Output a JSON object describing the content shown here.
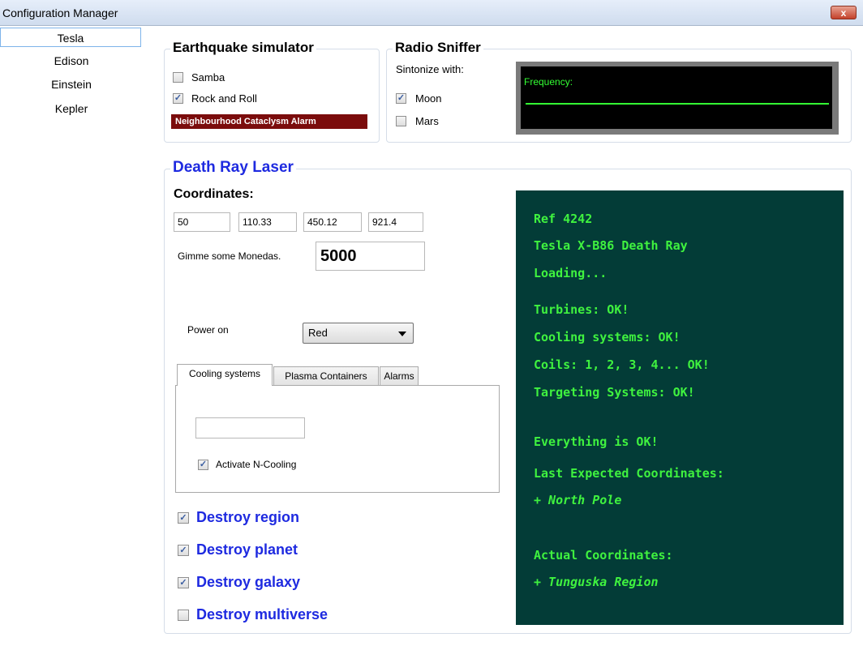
{
  "window": {
    "title": "Configuration Manager",
    "close_label": "x"
  },
  "sidebar": {
    "items": [
      {
        "label": "Tesla",
        "active": true
      },
      {
        "label": "Edison"
      },
      {
        "label": "Einstein"
      },
      {
        "label": "Kepler"
      }
    ]
  },
  "earthquake": {
    "title": "Earthquake simulator",
    "options": [
      {
        "label": "Samba",
        "checked": false
      },
      {
        "label": "Rock and Roll",
        "checked": true
      }
    ],
    "alarm_label": "Neighbourhood Cataclysm Alarm",
    "alarm_color": "#7b0c0c"
  },
  "radio": {
    "title": "Radio Sniffer",
    "subtitle": "Sintonize with:",
    "options": [
      {
        "label": "Moon",
        "checked": true
      },
      {
        "label": "Mars",
        "checked": false
      }
    ],
    "frequency_label": "Frequency:",
    "display_color": "#33ff33"
  },
  "laser": {
    "title": "Death Ray Laser",
    "title_color": "#1e2ae0",
    "coordinates_label": "Coordinates:",
    "coordinates": [
      "50",
      "110.33",
      "450.12",
      "921.4"
    ],
    "monedas_label": "Gimme some Monedas.",
    "monedas_value": "5000",
    "power_label": "Power on",
    "power_value": "Red",
    "tabs": [
      {
        "label": "Cooling systems",
        "active": true
      },
      {
        "label": "Plasma Containers"
      },
      {
        "label": "Alarms"
      }
    ],
    "cooling_input": "",
    "ncooling_label": "Activate N-Cooling",
    "ncooling_checked": true,
    "destroy": [
      {
        "label": "Destroy region",
        "checked": true
      },
      {
        "label": "Destroy planet",
        "checked": true
      },
      {
        "label": "Destroy galaxy",
        "checked": true
      },
      {
        "label": "Destroy multiverse",
        "checked": false
      }
    ]
  },
  "console": {
    "bg_color": "#033c37",
    "text_color": "#3ff23f",
    "lines": [
      "Ref 4242",
      "Tesla X-B86 Death Ray",
      "Loading...",
      "Turbines: OK!",
      "Cooling systems: OK!",
      "Coils: 1, 2, 3, 4... OK!",
      "Targeting Systems: OK!",
      "Everything is OK!",
      "Last Expected Coordinates:",
      "+ North Pole",
      "Actual Coordinates:",
      "+ Tunguska Region"
    ]
  }
}
